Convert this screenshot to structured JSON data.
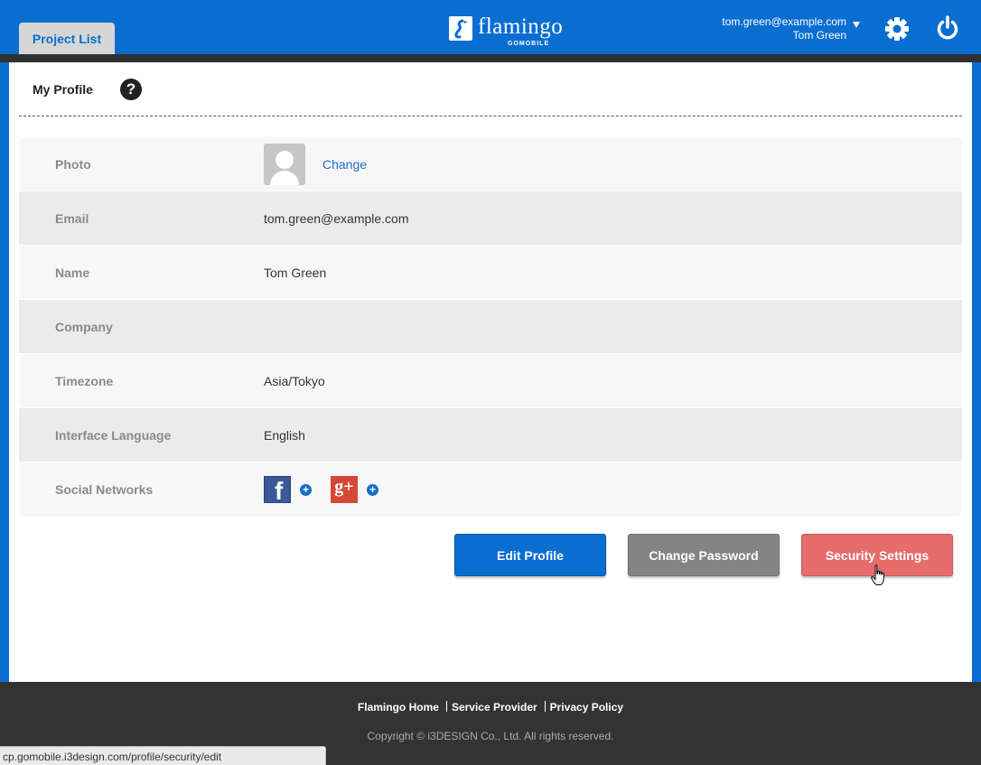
{
  "header": {
    "tab_project_list": "Project List",
    "logo_text": "flamingo",
    "logo_sub": "GOMOBILE",
    "user_email": "tom.green@example.com",
    "user_name": "Tom Green"
  },
  "page": {
    "title": "My Profile",
    "help_icon": "?"
  },
  "profile": {
    "photo_label": "Photo",
    "photo_change": "Change",
    "rows": [
      {
        "label": "Email",
        "value": "tom.green@example.com"
      },
      {
        "label": "Name",
        "value": "Tom Green"
      },
      {
        "label": "Company",
        "value": ""
      },
      {
        "label": "Timezone",
        "value": "Asia/Tokyo"
      },
      {
        "label": "Interface Language",
        "value": "English"
      }
    ],
    "social_label": "Social Networks",
    "social": [
      {
        "name": "facebook-icon",
        "glyph": "f"
      },
      {
        "name": "google-plus-icon",
        "glyph": "g+"
      }
    ],
    "add_icon": "+"
  },
  "actions": {
    "edit_profile": "Edit Profile",
    "change_password": "Change Password",
    "security_settings": "Security Settings"
  },
  "footer": {
    "links": [
      "Flamingo Home",
      "Service Provider",
      "Privacy Policy"
    ],
    "copyright": "Copyright © i3DESIGN Co., Ltd. All rights reserved."
  },
  "status_bar": {
    "url": "cp.gomobile.i3design.com/profile/security/edit"
  },
  "colors": {
    "primary": "#0a6ed1",
    "danger": "#e76c6c",
    "neutral": "#848484",
    "footer": "#333333"
  }
}
